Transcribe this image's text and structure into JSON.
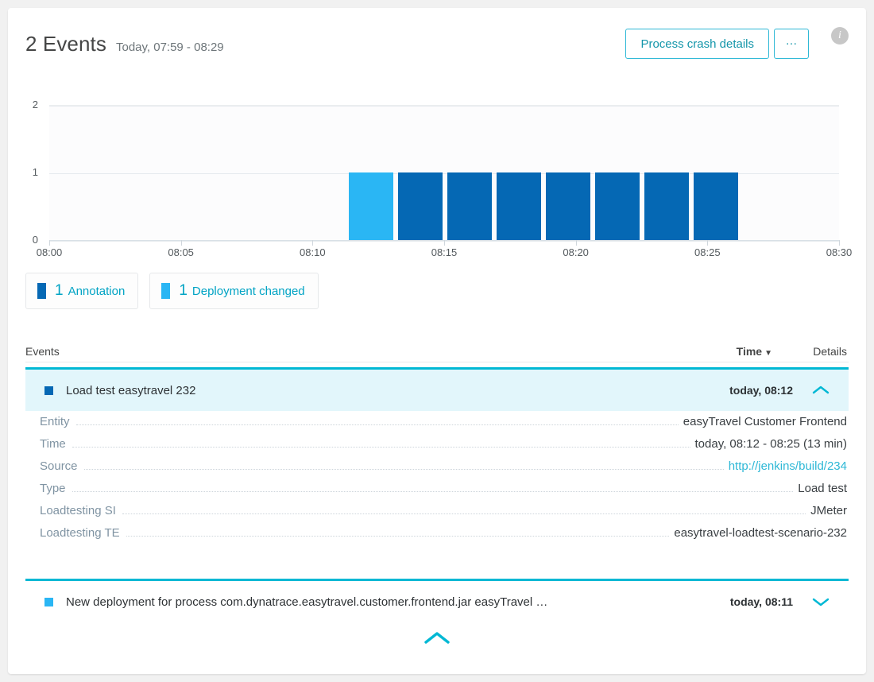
{
  "header": {
    "title": "2 Events",
    "subtitle": "Today, 07:59 - 08:29",
    "primary_button": "Process crash details",
    "ellipsis_button": "…",
    "info_icon_label": "i"
  },
  "colors": {
    "annotation": "#0568b4",
    "deployment": "#2ab6f4",
    "accent_cyan": "#00b8d4",
    "link": "#2eb8d6",
    "selected_row_bg": "#e2f6fb",
    "page_bg": "#f1f1f1"
  },
  "chart_data": {
    "type": "bar",
    "title": "",
    "xlabel": "",
    "ylabel": "",
    "ylim": [
      0,
      2
    ],
    "yticks": [
      "0",
      "1",
      "2"
    ],
    "xticks": [
      "08:00",
      "08:05",
      "08:10",
      "08:15",
      "08:20",
      "08:25",
      "08:30"
    ],
    "grid": true,
    "legend_position": "below",
    "categories": [
      "08:11",
      "08:13",
      "08:15",
      "08:17",
      "08:19",
      "08:21",
      "08:23",
      "08:25"
    ],
    "values": [
      1,
      1,
      1,
      1,
      1,
      1,
      1,
      1
    ],
    "bar_colors": [
      "#2ab6f4",
      "#0568b4",
      "#0568b4",
      "#0568b4",
      "#0568b4",
      "#0568b4",
      "#0568b4",
      "#0568b4"
    ],
    "series": [
      {
        "name": "Deployment changed",
        "color": "#2ab6f4",
        "values": [
          1,
          0,
          0,
          0,
          0,
          0,
          0,
          0
        ]
      },
      {
        "name": "Annotation",
        "color": "#0568b4",
        "values": [
          0,
          1,
          1,
          1,
          1,
          1,
          1,
          1
        ]
      }
    ]
  },
  "legend": [
    {
      "count": "1",
      "label": "Annotation",
      "color": "#0568b4"
    },
    {
      "count": "1",
      "label": "Deployment changed",
      "color": "#2ab6f4"
    }
  ],
  "table": {
    "headers": {
      "events": "Events",
      "time": "Time",
      "sort_arrow": "▼",
      "details": "Details"
    },
    "rows": [
      {
        "title": "Load test easytravel 232",
        "time": "today, 08:12",
        "marker_color": "#0568b4",
        "expanded": true,
        "chevron": "up",
        "details": [
          {
            "key": "Entity",
            "value": "easyTravel Customer Frontend",
            "is_link": false
          },
          {
            "key": "Time",
            "value": "today, 08:12 - 08:25 (13 min)",
            "is_link": false
          },
          {
            "key": "Source",
            "value": "http://jenkins/build/234",
            "is_link": true
          },
          {
            "key": "Type",
            "value": "Load test",
            "is_link": false
          },
          {
            "key": "Loadtesting SI",
            "value": "JMeter",
            "is_link": false
          },
          {
            "key": "Loadtesting TE",
            "value": "easytravel-loadtest-scenario-232",
            "is_link": false
          }
        ]
      },
      {
        "title": "New deployment for process com.dynatrace.easytravel.customer.frontend.jar easyTravel …",
        "time": "today, 08:11",
        "marker_color": "#2ab6f4",
        "expanded": false,
        "chevron": "down",
        "details": []
      }
    ]
  },
  "footer": {
    "collapse_icon": "chevron-up-icon"
  }
}
